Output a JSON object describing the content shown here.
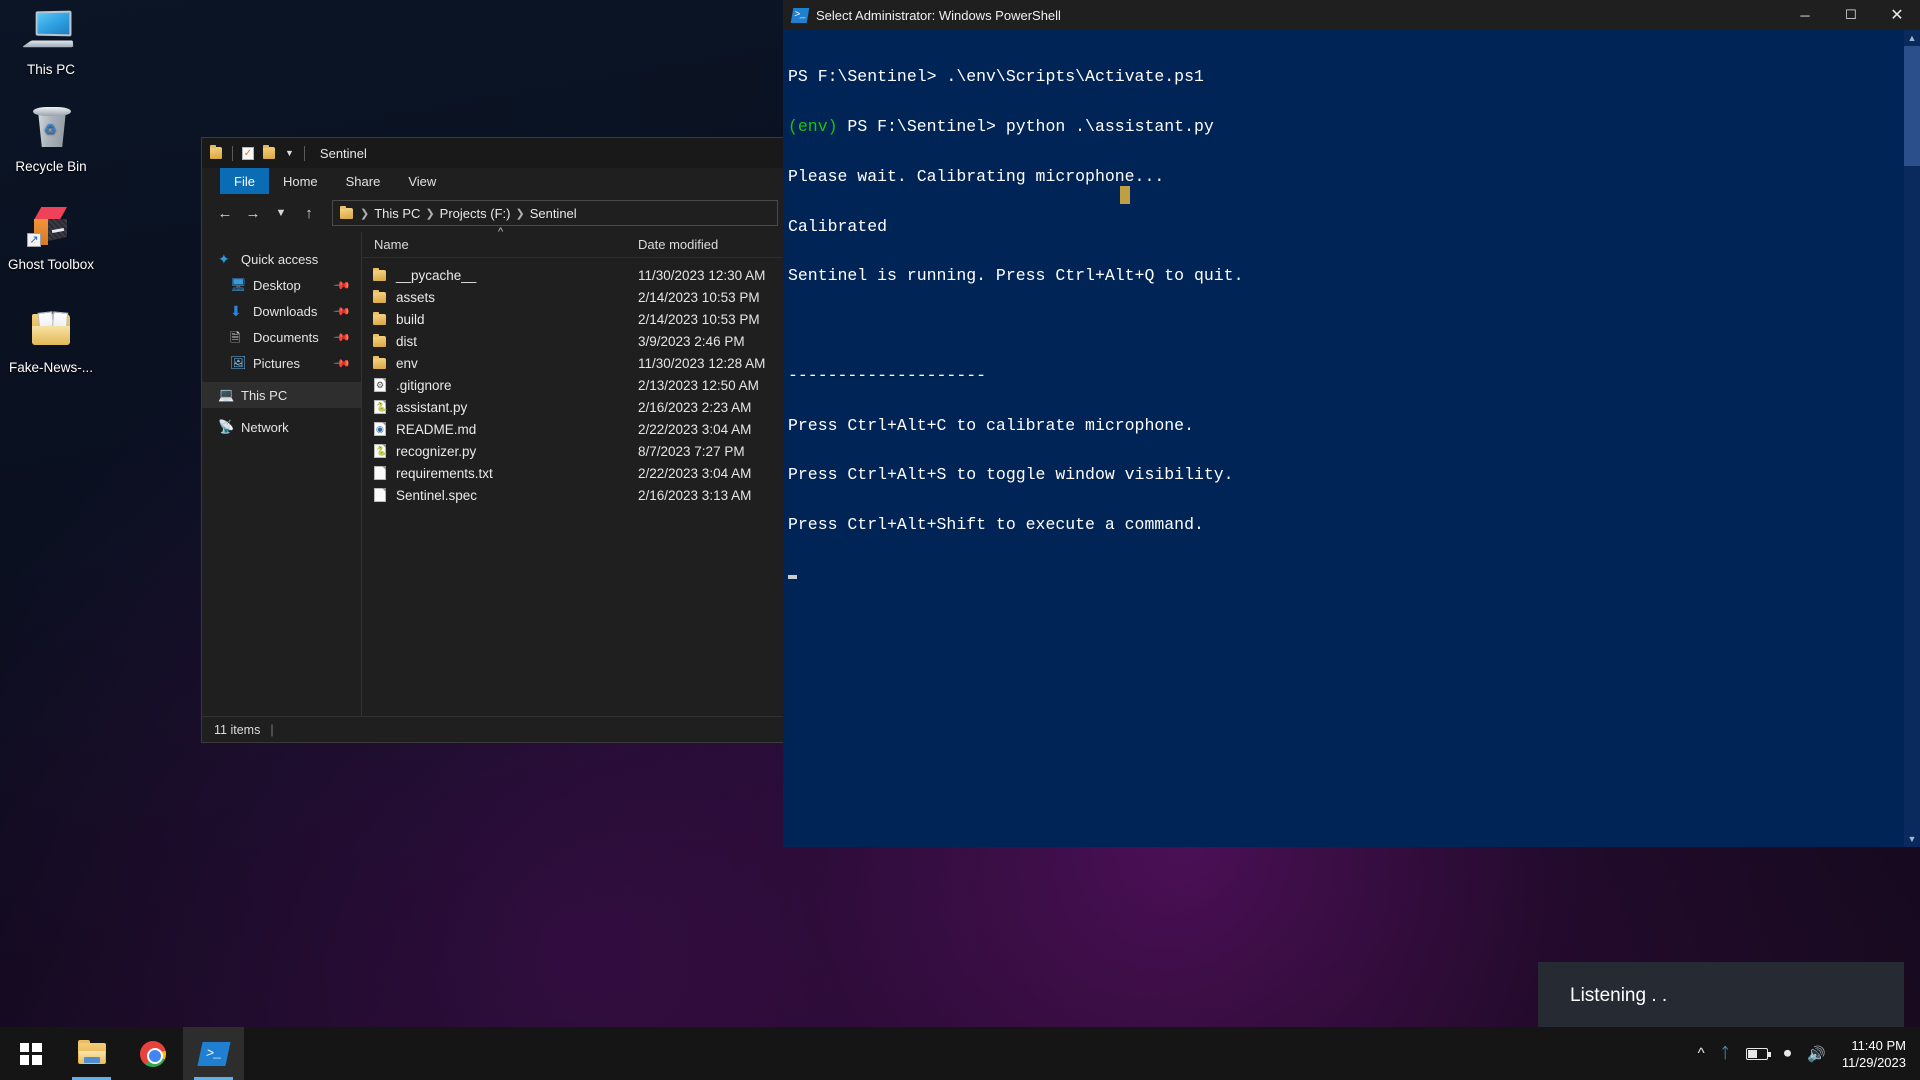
{
  "desktop": {
    "icons": [
      {
        "label": "This PC",
        "icon": "this-pc-icon"
      },
      {
        "label": "Recycle Bin",
        "icon": "recycle-bin-icon"
      },
      {
        "label": "Ghost Toolbox",
        "icon": "ghost-toolbox-shortcut-icon"
      },
      {
        "label": "Fake-News-...",
        "icon": "folder-shortcut-icon"
      }
    ]
  },
  "explorer": {
    "title": "Sentinel",
    "quick_access": {
      "folder_icon": "folder-icon",
      "properties_icon": "properties-checkbox-icon",
      "new_folder_icon": "new-folder-icon",
      "customize_icon": "chevron-down-icon"
    },
    "ribbon_tabs": [
      {
        "label": "File",
        "active": true
      },
      {
        "label": "Home",
        "active": false
      },
      {
        "label": "Share",
        "active": false
      },
      {
        "label": "View",
        "active": false
      }
    ],
    "nav": {
      "back": "back-arrow-icon",
      "forward": "forward-arrow-icon",
      "recent": "recent-locations-chevron-icon",
      "up": "up-arrow-icon"
    },
    "breadcrumb": [
      "This PC",
      "Projects (F:)",
      "Sentinel"
    ],
    "sidebar": [
      {
        "label": "Quick access",
        "icon": "star-icon",
        "indent": false,
        "pinned": false,
        "selected": false
      },
      {
        "label": "Desktop",
        "icon": "desktop-icon",
        "indent": true,
        "pinned": true,
        "selected": false
      },
      {
        "label": "Downloads",
        "icon": "downloads-icon",
        "indent": true,
        "pinned": true,
        "selected": false
      },
      {
        "label": "Documents",
        "icon": "documents-icon",
        "indent": true,
        "pinned": true,
        "selected": false
      },
      {
        "label": "Pictures",
        "icon": "pictures-icon",
        "indent": true,
        "pinned": true,
        "selected": false
      },
      {
        "label": "This PC",
        "icon": "this-pc-icon",
        "indent": false,
        "pinned": false,
        "selected": true
      },
      {
        "label": "Network",
        "icon": "network-icon",
        "indent": false,
        "pinned": false,
        "selected": false
      }
    ],
    "columns": {
      "name": "Name",
      "date_modified": "Date modified"
    },
    "sort": {
      "column": "Name",
      "direction": "ascending",
      "indicator": "^"
    },
    "files": [
      {
        "name": "__pycache__",
        "date": "11/30/2023 12:30 AM",
        "type": "folder"
      },
      {
        "name": "assets",
        "date": "2/14/2023 10:53 PM",
        "type": "folder"
      },
      {
        "name": "build",
        "date": "2/14/2023 10:53 PM",
        "type": "folder"
      },
      {
        "name": "dist",
        "date": "3/9/2023 2:46 PM",
        "type": "folder"
      },
      {
        "name": "env",
        "date": "11/30/2023 12:28 AM",
        "type": "folder"
      },
      {
        "name": ".gitignore",
        "date": "2/13/2023 12:50 AM",
        "type": "config"
      },
      {
        "name": "assistant.py",
        "date": "2/16/2023 2:23 AM",
        "type": "python"
      },
      {
        "name": "README.md",
        "date": "2/22/2023 3:04 AM",
        "type": "markdown"
      },
      {
        "name": "recognizer.py",
        "date": "8/7/2023 7:27 PM",
        "type": "python"
      },
      {
        "name": "requirements.txt",
        "date": "2/22/2023 3:04 AM",
        "type": "text"
      },
      {
        "name": "Sentinel.spec",
        "date": "2/16/2023 3:13 AM",
        "type": "text"
      }
    ],
    "status": {
      "item_count": "11 items",
      "separator": "|"
    }
  },
  "powershell": {
    "title": "Select Administrator: Windows PowerShell",
    "icon": "powershell-icon",
    "window_controls": {
      "minimize": "─",
      "maximize": "☐",
      "close": "✕"
    },
    "lines": [
      {
        "text": "PS F:\\Sentinel> .\\env\\Scripts\\Activate.ps1"
      },
      {
        "prefix": "(env)",
        "text": " PS F:\\Sentinel> python .\\assistant.py"
      },
      {
        "text": "Please wait. Calibrating microphone..."
      },
      {
        "text": "Calibrated"
      },
      {
        "text": "Sentinel is running. Press Ctrl+Alt+Q to quit."
      },
      {
        "text": ""
      },
      {
        "text": "--------------------"
      },
      {
        "text": "Press Ctrl+Alt+C to calibrate microphone."
      },
      {
        "text": "Press Ctrl+Alt+S to toggle window visibility."
      },
      {
        "text": "Press Ctrl+Alt+Shift to execute a command."
      }
    ],
    "env_color": "#16c60c",
    "background_color": "#012456"
  },
  "listening_overlay": {
    "text": "Listening . ."
  },
  "taskbar": {
    "buttons": [
      {
        "name": "start",
        "icon": "windows-logo-icon",
        "active": false
      },
      {
        "name": "file-explorer",
        "icon": "folder-icon",
        "active": true,
        "underline": true
      },
      {
        "name": "chrome",
        "icon": "chrome-icon",
        "active": false
      },
      {
        "name": "powershell",
        "icon": "powershell-icon",
        "active": true,
        "underline": true
      }
    ],
    "tray": {
      "show_hidden": "chevron-up-icon",
      "bluetooth": "bluetooth-icon",
      "battery": "battery-icon",
      "wifi": "wifi-icon",
      "volume": "volume-icon",
      "time": "11:40 PM",
      "date": "11/29/2023"
    }
  }
}
